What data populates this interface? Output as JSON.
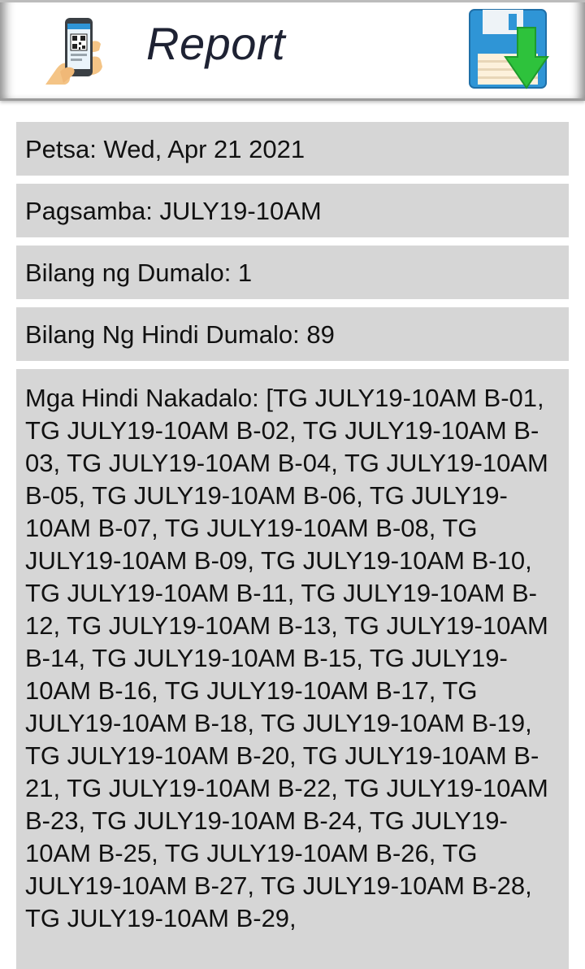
{
  "header": {
    "title": "Report",
    "app_icon": "phone-qr-code-icon",
    "save_icon": "floppy-disk-download-icon"
  },
  "report": {
    "date_line": "Petsa: Wed, Apr 21 2021",
    "service_line": "Pagsamba: JULY19-10AM",
    "attended_line": "Bilang ng Dumalo: 1",
    "absent_count_line": "Bilang Ng Hindi Dumalo: 89",
    "absent_list_line": "Mga Hindi Nakadalo: [TG JULY19-10AM B-01, TG JULY19-10AM B-02, TG JULY19-10AM B-03, TG JULY19-10AM B-04, TG JULY19-10AM B-05, TG JULY19-10AM B-06, TG JULY19-10AM B-07, TG JULY19-10AM B-08, TG JULY19-10AM B-09, TG JULY19-10AM B-10, TG JULY19-10AM B-11, TG JULY19-10AM B-12, TG JULY19-10AM B-13, TG JULY19-10AM B-14, TG JULY19-10AM B-15, TG JULY19-10AM B-16, TG JULY19-10AM B-17, TG JULY19-10AM B-18, TG JULY19-10AM B-19, TG JULY19-10AM B-20, TG JULY19-10AM B-21, TG JULY19-10AM B-22, TG JULY19-10AM B-23, TG JULY19-10AM B-24, TG JULY19-10AM B-25, TG JULY19-10AM B-26, TG JULY19-10AM B-27, TG JULY19-10AM B-28, TG JULY19-10AM B-29,"
  },
  "colors": {
    "row_background": "#d6d6d6",
    "title_text": "#1e2233",
    "save_icon_blue": "#2f95d6",
    "save_icon_arrow": "#2ec23c"
  }
}
